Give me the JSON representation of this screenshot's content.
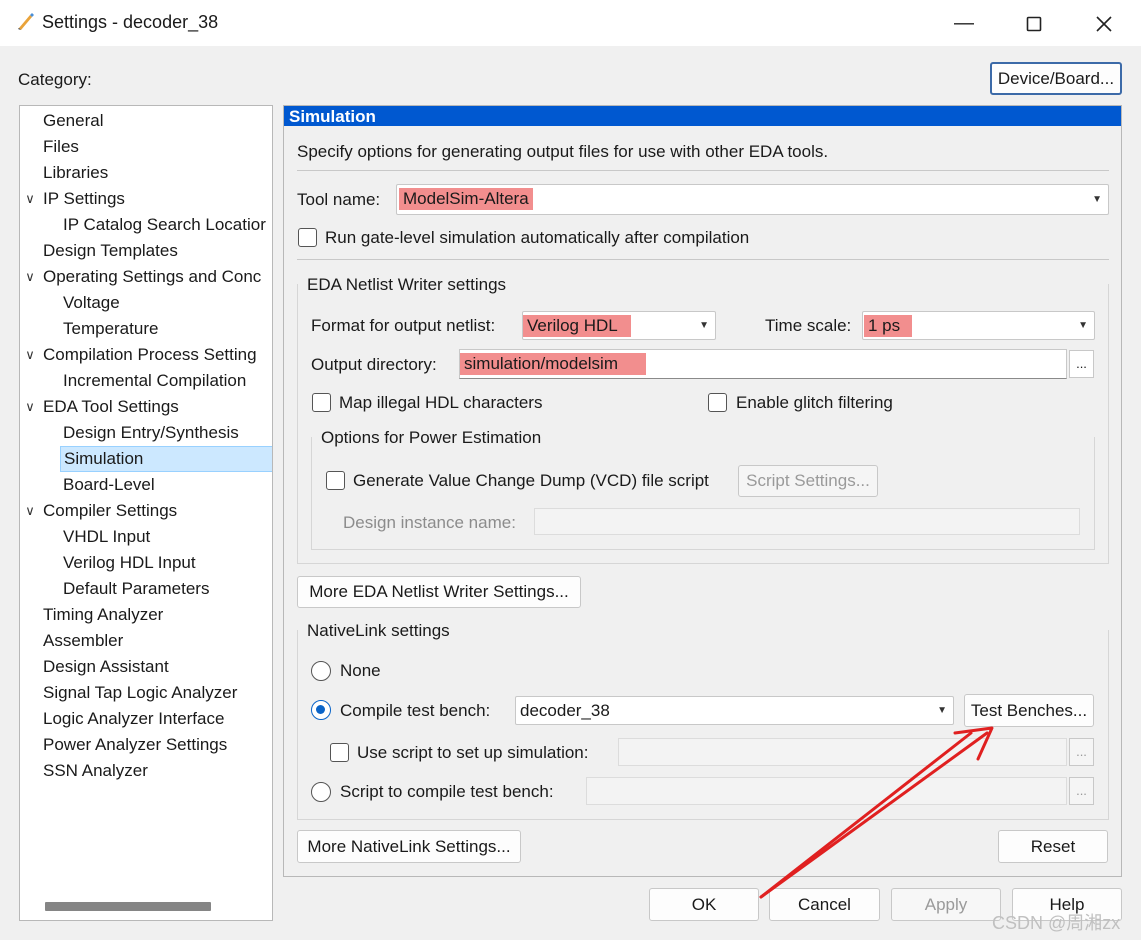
{
  "window": {
    "title": "Settings - decoder_38",
    "category_label": "Category:",
    "device_board_button": "Device/Board..."
  },
  "tree": {
    "items": [
      {
        "label": "General",
        "level": 0
      },
      {
        "label": "Files",
        "level": 0
      },
      {
        "label": "Libraries",
        "level": 0
      },
      {
        "label": "IP Settings",
        "level": 0,
        "expanded": true
      },
      {
        "label": "IP Catalog Search Locatior",
        "level": 1
      },
      {
        "label": "Design Templates",
        "level": 0
      },
      {
        "label": "Operating Settings and Conc",
        "level": 0,
        "expanded": true
      },
      {
        "label": "Voltage",
        "level": 1
      },
      {
        "label": "Temperature",
        "level": 1
      },
      {
        "label": "Compilation Process Setting",
        "level": 0,
        "expanded": true
      },
      {
        "label": "Incremental Compilation",
        "level": 1
      },
      {
        "label": "EDA Tool Settings",
        "level": 0,
        "expanded": true
      },
      {
        "label": "Design Entry/Synthesis",
        "level": 1
      },
      {
        "label": "Simulation",
        "level": 1,
        "selected": true
      },
      {
        "label": "Board-Level",
        "level": 1
      },
      {
        "label": "Compiler Settings",
        "level": 0,
        "expanded": true
      },
      {
        "label": "VHDL Input",
        "level": 1
      },
      {
        "label": "Verilog HDL Input",
        "level": 1
      },
      {
        "label": "Default Parameters",
        "level": 1
      },
      {
        "label": "Timing Analyzer",
        "level": 0
      },
      {
        "label": "Assembler",
        "level": 0
      },
      {
        "label": "Design Assistant",
        "level": 0
      },
      {
        "label": "Signal Tap Logic Analyzer",
        "level": 0
      },
      {
        "label": "Logic Analyzer Interface",
        "level": 0
      },
      {
        "label": "Power Analyzer Settings",
        "level": 0
      },
      {
        "label": "SSN Analyzer",
        "level": 0
      }
    ]
  },
  "panel": {
    "header": "Simulation",
    "description": "Specify options for generating output files for use with other EDA tools.",
    "tool_name_label": "Tool name:",
    "tool_name_value": "ModelSim-Altera",
    "run_gate_level_label": "Run gate-level simulation automatically after compilation",
    "netlist_group_title": "EDA Netlist Writer settings",
    "format_label": "Format for output netlist:",
    "format_value": "Verilog HDL",
    "time_scale_label": "Time scale:",
    "time_scale_value": "1 ps",
    "output_dir_label": "Output directory:",
    "output_dir_value": "simulation/modelsim",
    "browse_label": "...",
    "map_illegal_label": "Map illegal HDL characters",
    "glitch_label": "Enable glitch filtering",
    "power_group_title": "Options for Power Estimation",
    "vcd_label": "Generate Value Change Dump (VCD) file script",
    "script_settings_button": "Script Settings...",
    "design_instance_label": "Design instance name:",
    "more_netlist_button": "More EDA Netlist Writer Settings...",
    "nativelink_group_title": "NativeLink settings",
    "none_label": "None",
    "compile_tb_label": "Compile test bench:",
    "compile_tb_value": "decoder_38",
    "test_benches_button": "Test Benches...",
    "use_script_label": "Use script to set up simulation:",
    "script_compile_label": "Script to compile test bench:",
    "more_nativelink_button": "More NativeLink Settings...",
    "reset_button": "Reset"
  },
  "footer": {
    "ok": "OK",
    "cancel": "Cancel",
    "apply": "Apply",
    "help": "Help"
  },
  "watermark": "CSDN @周湘zx",
  "colors": {
    "header_blue": "#0058d0",
    "highlight_red": "#f28e8e",
    "arrow_red": "#e02020",
    "selected_bg": "#cce8ff"
  }
}
